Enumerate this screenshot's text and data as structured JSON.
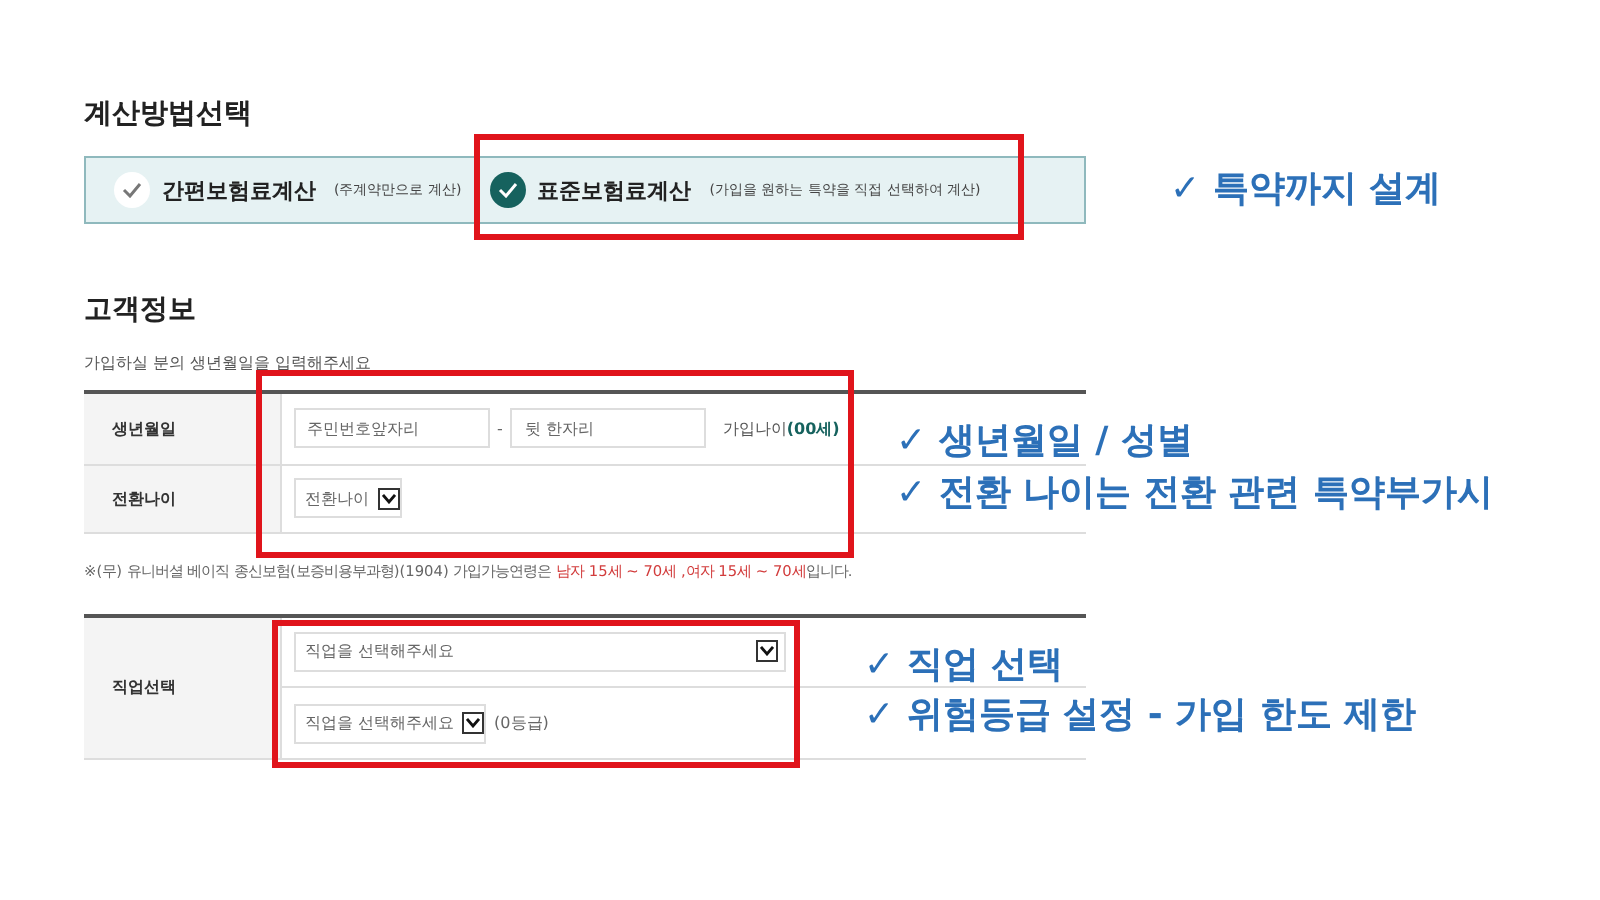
{
  "calc_method": {
    "title": "계산방법선택",
    "options": [
      {
        "label": "간편보험료계산",
        "note": "(주계약만으로 계산)",
        "selected": false
      },
      {
        "label": "표준보험료계산",
        "note": "(가입을 원하는 특약을 직접 선택하여 계산)",
        "selected": true
      }
    ]
  },
  "customer": {
    "title": "고객정보",
    "hint": "가입하실 분의 생년월일을 입력해주세요",
    "birth": {
      "label": "생년월일",
      "front_placeholder": "주민번호앞자리",
      "dash": "-",
      "back_placeholder": "뒷 한자리",
      "age_label": "가입나이",
      "age_value": "(00세)"
    },
    "conversion": {
      "label": "전환나이",
      "select": "전환나이"
    },
    "notice": "※(무) 유니버셜 베이직 종신보험(보증비용부과형)(1904) 가입가능연령은 **남자 15세 ~ 70세 ,여자 15세 ~ 70세**입니다.",
    "job": {
      "label": "직업선택",
      "select": "직업을 선택해주세요",
      "risk_select": "직업을 선택해주세요",
      "grade": "(0등급)"
    }
  },
  "notes": [
    {
      "text": "✓ 특약까지 설계"
    },
    {
      "text": "✓ 생년월일 / 성별"
    },
    {
      "text": "✓ 전환 나이는 전환 관련 특약부가시"
    },
    {
      "text": "✓ 직업 선택"
    },
    {
      "text": "✓ 위험등급 설정 - 가입 한도 제한"
    }
  ]
}
